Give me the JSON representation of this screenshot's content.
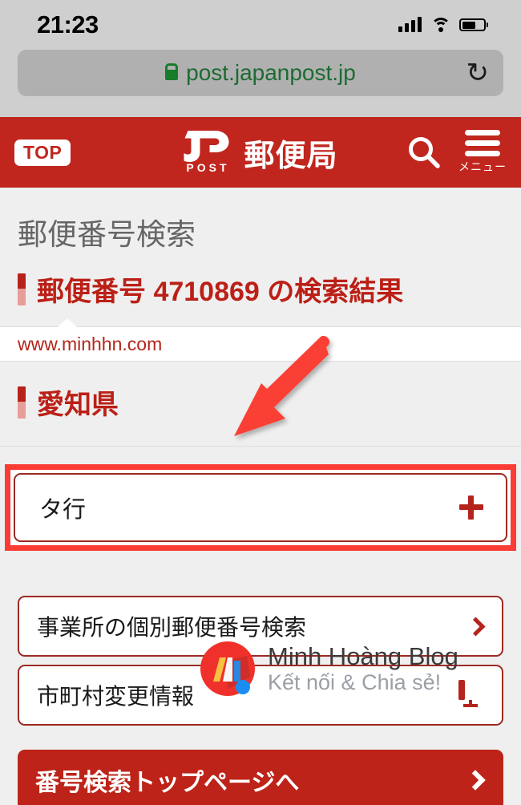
{
  "status_bar": {
    "time": "21:23",
    "signal_icon": "cellular-bars-icon",
    "wifi_icon": "wifi-icon",
    "battery_icon": "battery-icon",
    "battery_level": 65
  },
  "browser": {
    "lock_icon": "lock-icon",
    "url": "post.japanpost.jp",
    "reload_icon": "↻",
    "reload_label": "reload-icon"
  },
  "header": {
    "top_button": "TOP",
    "logo_text": "POST",
    "logo_name": "jp-post-logo",
    "brand_name": "郵便局",
    "search_icon": "search-icon",
    "menu_icon": "hamburger-menu-icon",
    "menu_label": "メニュー"
  },
  "main": {
    "page_title": "郵便番号検索",
    "result_heading": "郵便番号 4710869 の検索結果",
    "postal_code": "4710869",
    "prefecture": "愛知県",
    "accordion": {
      "label": "タ行",
      "expand_icon": "plus-icon"
    },
    "links": [
      {
        "label": "事業所の個別郵便番号検索",
        "icon": "chevron-right-icon"
      },
      {
        "label": "市町村変更情報",
        "icon": "desktop-monitor-icon"
      }
    ],
    "cta": {
      "label": "番号検索トップページへ",
      "icon": "chevron-right-icon"
    }
  },
  "watermark": {
    "url": "www.minhhn.com",
    "blog_title": "Minh Hoàng Blog",
    "blog_tagline": "Kết nối & Chia sẻ!",
    "logo_name": "minh-hoang-blog-logo"
  },
  "annotations": {
    "arrow_name": "red-arrow-annotation",
    "highlight_name": "red-highlight-box-annotation"
  },
  "colors": {
    "brand_red": "#C0261E",
    "accent_red": "#BB2017",
    "annotation_red": "#FA3C35",
    "page_bg": "#EFEFEF",
    "chrome_bg": "#CFCFCF",
    "url_green": "#1D6B32"
  }
}
